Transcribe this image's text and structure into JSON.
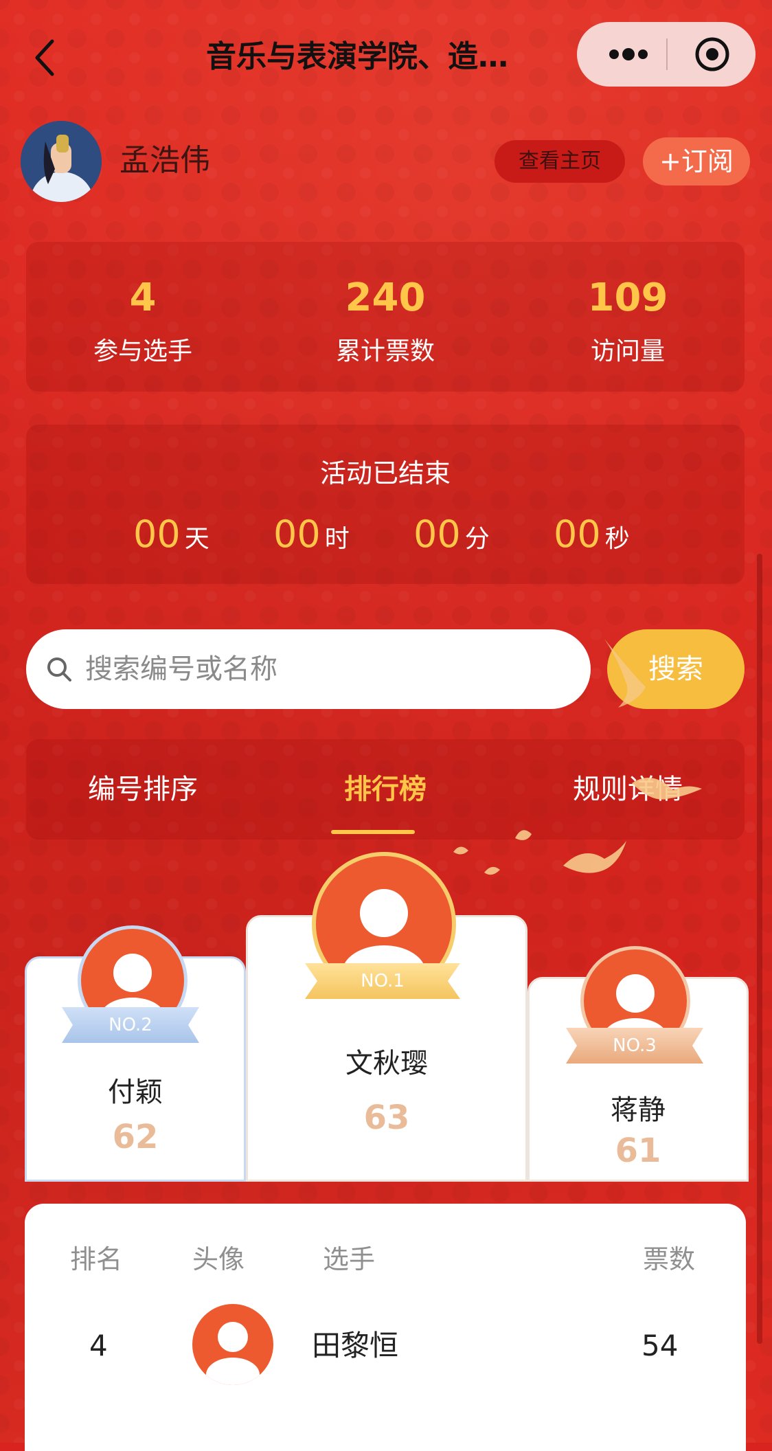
{
  "header": {
    "title": "音乐与表演学院、造…"
  },
  "organizer": {
    "name": "孟浩伟",
    "homepage_label": "查看主页",
    "subscribe_label": "+订阅"
  },
  "stats": [
    {
      "value": "4",
      "label": "参与选手"
    },
    {
      "value": "240",
      "label": "累计票数"
    },
    {
      "value": "109",
      "label": "访问量"
    }
  ],
  "countdown": {
    "status": "活动已结束",
    "units": [
      {
        "value": "00",
        "unit": "天"
      },
      {
        "value": "00",
        "unit": "时"
      },
      {
        "value": "00",
        "unit": "分"
      },
      {
        "value": "00",
        "unit": "秒"
      }
    ]
  },
  "search": {
    "placeholder": "搜索编号或名称",
    "button_label": "搜索"
  },
  "tabs": [
    {
      "label": "编号排序"
    },
    {
      "label": "排行榜",
      "active": true
    },
    {
      "label": "规则详情"
    }
  ],
  "podium": [
    {
      "rank_label": "NO.1",
      "name": "文秋璎",
      "votes": "63"
    },
    {
      "rank_label": "NO.2",
      "name": "付颖",
      "votes": "62"
    },
    {
      "rank_label": "NO.3",
      "name": "蒋静",
      "votes": "61"
    }
  ],
  "ranking_table": {
    "headers": [
      "排名",
      "头像",
      "选手",
      "票数"
    ],
    "rows": [
      {
        "rank": "4",
        "name": "田黎恒",
        "votes": "54"
      }
    ]
  },
  "colors": {
    "background": "#d9231f",
    "accent": "#ffc64a",
    "avatar_orange": "#ee5a2f",
    "votes_text": "#e9bb98"
  },
  "icons": [
    "back-chevron-icon",
    "more-dots-icon",
    "target-close-icon",
    "search-icon",
    "avatar-placeholder-icon"
  ]
}
